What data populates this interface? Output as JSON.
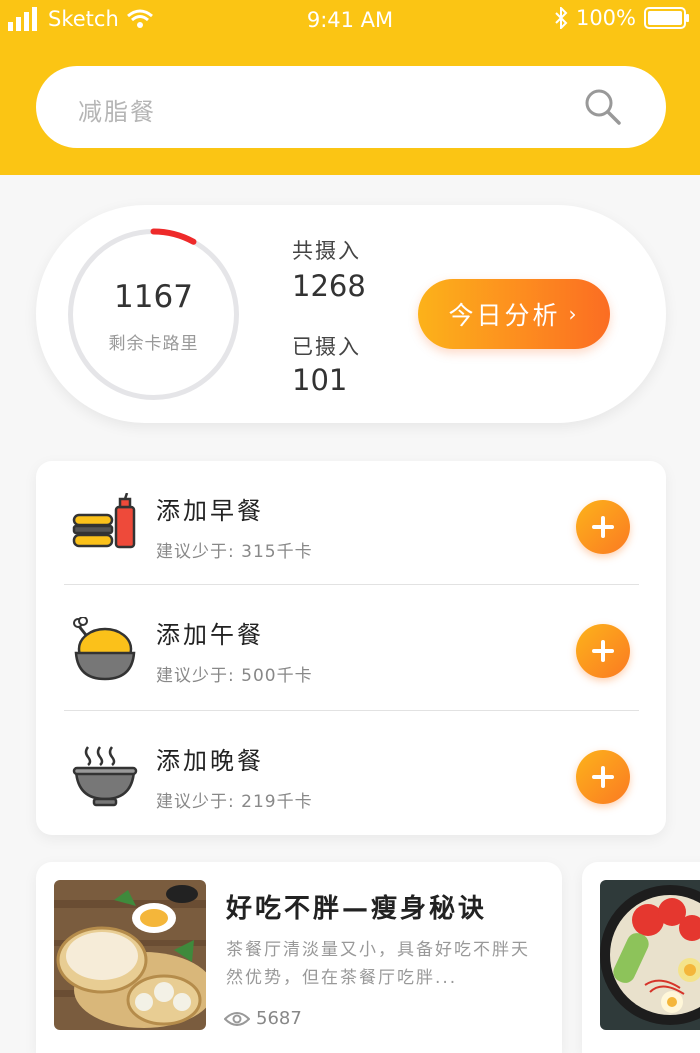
{
  "status_bar": {
    "carrier": "Sketch",
    "time": "9:41 AM",
    "battery": "100%"
  },
  "search": {
    "placeholder": "减脂餐"
  },
  "summary": {
    "remaining_value": "1167",
    "remaining_label": "剩余卡路里",
    "total_label": "共摄入",
    "total_value": "1268",
    "consumed_label": "已摄入",
    "consumed_value": "101",
    "progress_fraction": 0.08,
    "analyze_label": "今日分析",
    "analyze_chevron": "›"
  },
  "meals": [
    {
      "title": "添加早餐",
      "suggestion": "建议少于: 315千卡",
      "icon": "burger-drink-icon"
    },
    {
      "title": "添加午餐",
      "suggestion": "建议少于: 500千卡",
      "icon": "chicken-bowl-icon"
    },
    {
      "title": "添加晚餐",
      "suggestion": "建议少于: 219千卡",
      "icon": "steaming-bowl-icon"
    }
  ],
  "articles": [
    {
      "title": "好吃不胖—瘦身秘诀",
      "desc": "茶餐厅清淡量又小，具备好吃不胖天然优势，但在茶餐厅吃胖...",
      "views": "5687"
    }
  ],
  "colors": {
    "brand": "#fbc514",
    "accent": "#fb7a22",
    "ring_progress": "#ee2a2a"
  }
}
